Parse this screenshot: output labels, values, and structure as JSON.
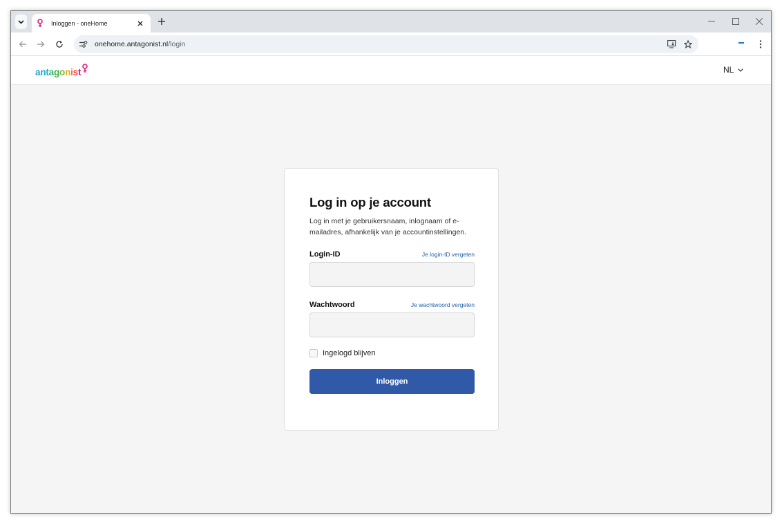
{
  "browser": {
    "tab_title": "Inloggen - oneHome",
    "url_host": "onehome.antagonist.nl",
    "url_path": "/login"
  },
  "site": {
    "brand": {
      "letters": [
        {
          "ch": "a",
          "color": "#1aa6d6"
        },
        {
          "ch": "n",
          "color": "#1aa6d6"
        },
        {
          "ch": "t",
          "color": "#13b5b0"
        },
        {
          "ch": "a",
          "color": "#2cba62"
        },
        {
          "ch": "g",
          "color": "#3bb54a"
        },
        {
          "ch": "o",
          "color": "#7ab83c"
        },
        {
          "ch": "n",
          "color": "#f2a81d"
        },
        {
          "ch": "i",
          "color": "#f27a1d"
        },
        {
          "ch": "s",
          "color": "#ef3d5a"
        },
        {
          "ch": "t",
          "color": "#e6197e"
        }
      ],
      "icon_color": "#e6197e"
    },
    "language": "NL"
  },
  "login": {
    "title": "Log in op je account",
    "description": "Log in met je gebruikersnaam, inlognaam of e-mailadres, afhankelijk van je accountinstellingen.",
    "login_id_label": "Login-ID",
    "login_id_link": "Je login-ID vergeten",
    "login_id_value": "",
    "password_label": "Wachtwoord",
    "password_link": "Je wachtwoord vergeten",
    "password_value": "",
    "remember_label": "Ingelogd blijven",
    "submit_label": "Inloggen",
    "accent_color": "#305aa8"
  }
}
